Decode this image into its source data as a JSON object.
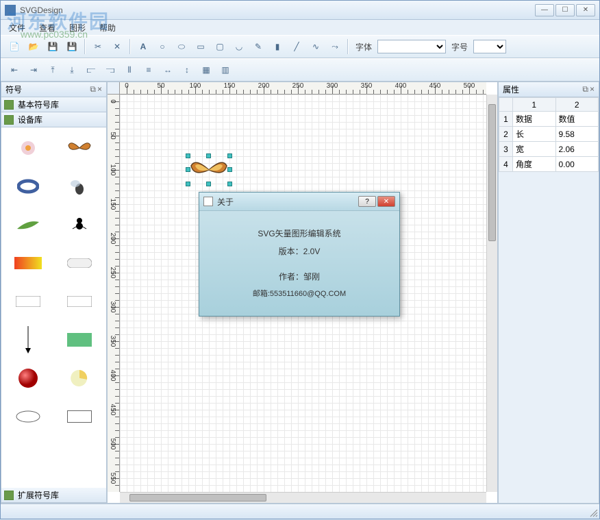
{
  "window": {
    "title": "SVGDesign"
  },
  "watermark": {
    "text": "河东软件园",
    "url": "www.pc0359.cn"
  },
  "menu": {
    "file": "文件",
    "view": "查看",
    "graphics": "图形",
    "help": "帮助"
  },
  "toolbar1": {
    "font_label": "字体",
    "size_label": "字号"
  },
  "panel_symbols": {
    "title": "符号",
    "basic_lib": "基本符号库",
    "device_lib": "设备库",
    "ext_lib": "扩展符号库"
  },
  "panel_props": {
    "title": "属性",
    "cols": [
      "1",
      "2"
    ],
    "rows": [
      {
        "n": "1",
        "k": "数据",
        "v": "数值"
      },
      {
        "n": "2",
        "k": "长",
        "v": "9.58"
      },
      {
        "n": "3",
        "k": "宽",
        "v": "2.06"
      },
      {
        "n": "4",
        "k": "角度",
        "v": "0.00"
      }
    ]
  },
  "ruler": {
    "major_h": [
      0,
      50,
      100,
      150,
      200,
      250,
      300,
      350,
      400,
      450,
      500
    ],
    "major_v": [
      0,
      50,
      100,
      150,
      200,
      250,
      300,
      350,
      400,
      450,
      500,
      550
    ]
  },
  "about": {
    "title": "关于",
    "line1": "SVG矢量图形编辑系统",
    "line2": "版本：2.0V",
    "line3": "作者：邹刚",
    "line4": "邮箱:553511660@QQ.COM"
  }
}
